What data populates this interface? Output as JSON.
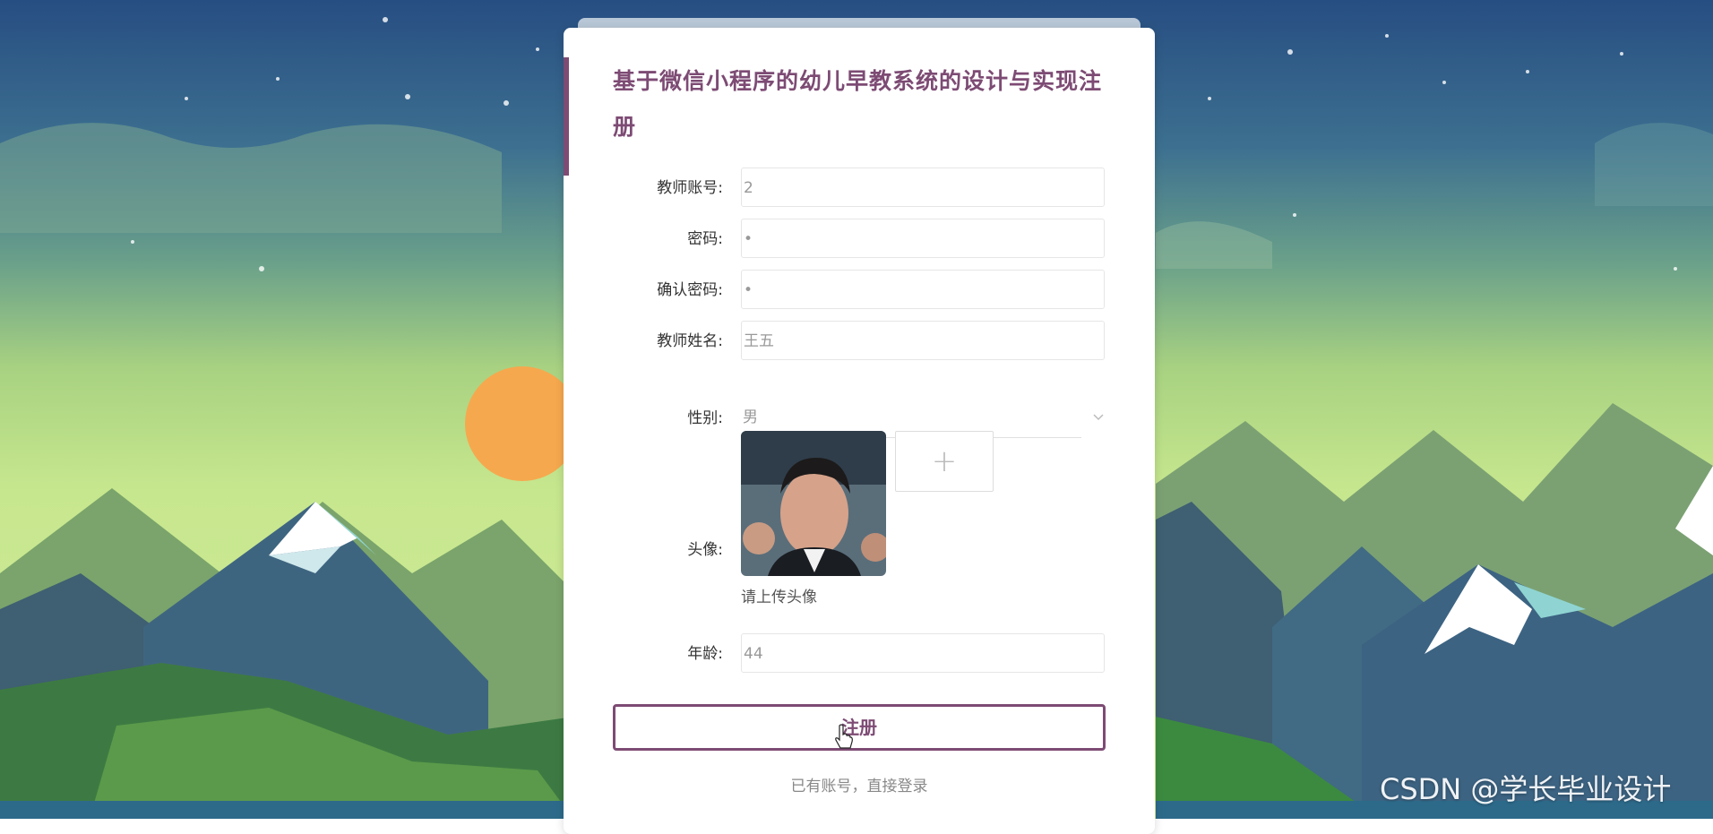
{
  "title": "基于微信小程序的幼儿早教系统的设计与实现注册",
  "form": {
    "account": {
      "label": "教师账号:",
      "value": "2"
    },
    "password": {
      "label": "密码:",
      "value": "•"
    },
    "confirm_password": {
      "label": "确认密码:",
      "value": "•"
    },
    "name": {
      "label": "教师姓名:",
      "value": "王五"
    },
    "gender": {
      "label": "性别:",
      "value": "男"
    },
    "avatar": {
      "label": "头像:",
      "upload_symbol": "+",
      "hint": "请上传头像"
    },
    "age": {
      "label": "年龄:",
      "value": "44"
    }
  },
  "submit_label": "注册",
  "login_link": "已有账号，直接登录",
  "watermark": "CSDN @学长毕业设计",
  "colors": {
    "accent": "#7d4b74",
    "card_tab": "#b8c7d6"
  },
  "icons": {
    "gender_dropdown": "chevron-down-icon",
    "upload": "plus-icon",
    "cursor": "hand-pointer-icon"
  }
}
